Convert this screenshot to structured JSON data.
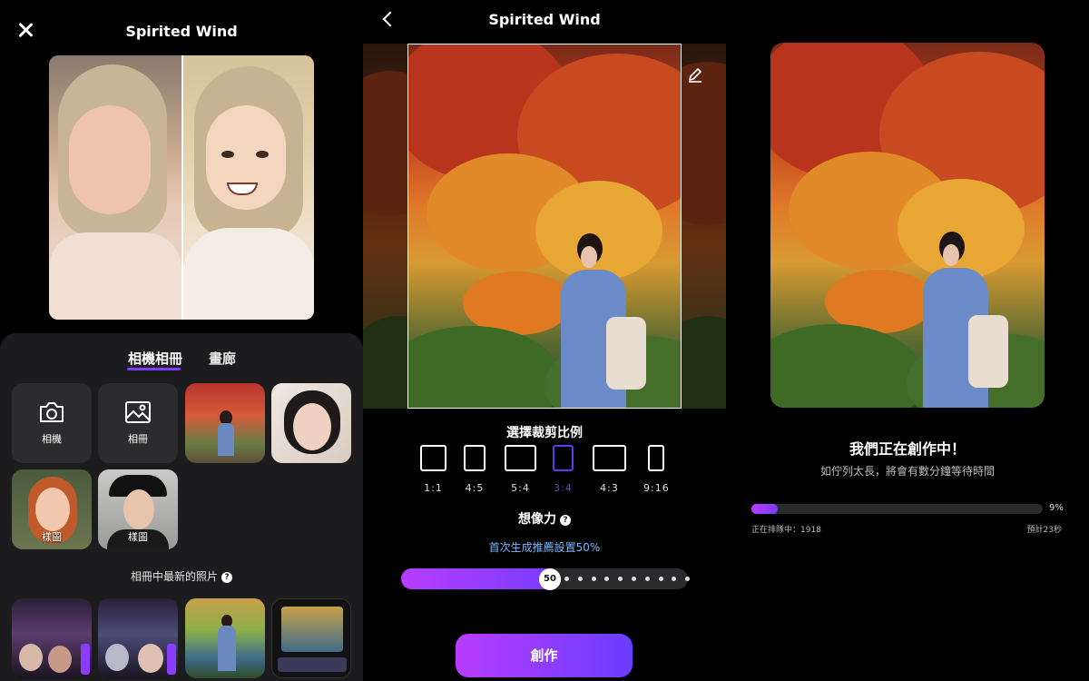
{
  "panel1": {
    "title": "Spirited Wind",
    "tabs": {
      "album": "相機相冊",
      "gallery": "畫廊"
    },
    "tiles": {
      "camera_label": "相機",
      "album_label": "相冊",
      "sample1_label": "樣圖",
      "sample2_label": "樣圖"
    },
    "recent_label": "相冊中最新的照片"
  },
  "panel2": {
    "title": "Spirited Wind",
    "crop_title": "選擇裁剪比例",
    "ratios": [
      {
        "label": "1:1"
      },
      {
        "label": "4:5"
      },
      {
        "label": "5:4"
      },
      {
        "label": "3:4",
        "selected": true
      },
      {
        "label": "4:3"
      },
      {
        "label": "9:16"
      }
    ],
    "imagination_title": "想像力",
    "imagination_hint": "首次生成推薦設置50%",
    "slider_value": "50",
    "slider_fraction": 0.5,
    "create_label": "創作"
  },
  "panel3": {
    "title": "我們正在創作中！",
    "subtitle": "如佇列太長，將會有數分鐘等待時間",
    "progress_percent": 9,
    "progress_label": "9%",
    "queue_text": "正在排隊中：1918",
    "eta_text": "預計23秒"
  },
  "colors": {
    "accent_purple": "#7a3cff",
    "accent_magenta": "#b83cff",
    "sheet_bg": "#1c1c1e",
    "hint_blue": "#7fb6ff"
  },
  "icons": [
    "close-icon",
    "camera-icon",
    "gallery-icon",
    "help-icon",
    "back-icon",
    "edit-icon"
  ]
}
